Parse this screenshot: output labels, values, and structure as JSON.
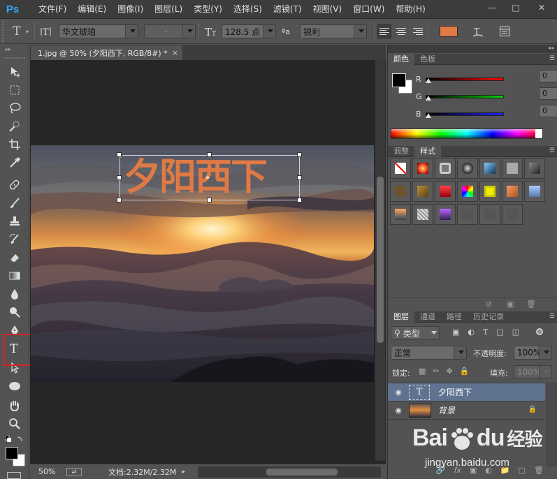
{
  "app": {
    "logo": "Ps",
    "menu": [
      "文件(F)",
      "编辑(E)",
      "图像(I)",
      "图层(L)",
      "类型(Y)",
      "选择(S)",
      "滤镜(T)",
      "视图(V)",
      "窗口(W)",
      "帮助(H)"
    ],
    "window_controls": [
      "minimize-icon",
      "maximize-icon",
      "close-icon"
    ]
  },
  "options": {
    "font_family": "华文琥珀",
    "font_style": "-",
    "font_size": "128.5 点",
    "aa_label": "ªa",
    "antialias": "锐利",
    "text_color": "#e07a45"
  },
  "document": {
    "tab_title": "1.jpg @ 50% (夕阳西下, RGB/8#) *",
    "tab_close": "×",
    "overlay_text": "夕阳西下",
    "text_color": "#e07a45"
  },
  "status": {
    "zoom": "50%",
    "doc_info": "文档:2.32M/2.32M"
  },
  "color_panel": {
    "tabs": [
      "颜色",
      "色板"
    ],
    "channels": [
      {
        "label": "R",
        "value": "0"
      },
      {
        "label": "G",
        "value": "0"
      },
      {
        "label": "B",
        "value": "0"
      }
    ],
    "foreground": "#000000",
    "background": "#ffffff"
  },
  "styles_panel": {
    "tabs": [
      "调整",
      "样式"
    ]
  },
  "layers_panel": {
    "tabs": [
      "图层",
      "通道",
      "路径",
      "历史记录"
    ],
    "filter_kind": "类型",
    "blend_mode": "正常",
    "opacity_label": "不透明度:",
    "opacity_value": "100%",
    "lock_label": "锁定:",
    "fill_label": "填充:",
    "fill_value": "100%",
    "layers": [
      {
        "name": "夕阳西下",
        "type": "text",
        "selected": true
      },
      {
        "name": "背景",
        "type": "image",
        "locked": true
      }
    ]
  },
  "watermark": {
    "brand": "Bai",
    "brand2": "du",
    "suffix": "经验",
    "url": "jingyan.baidu.com"
  }
}
